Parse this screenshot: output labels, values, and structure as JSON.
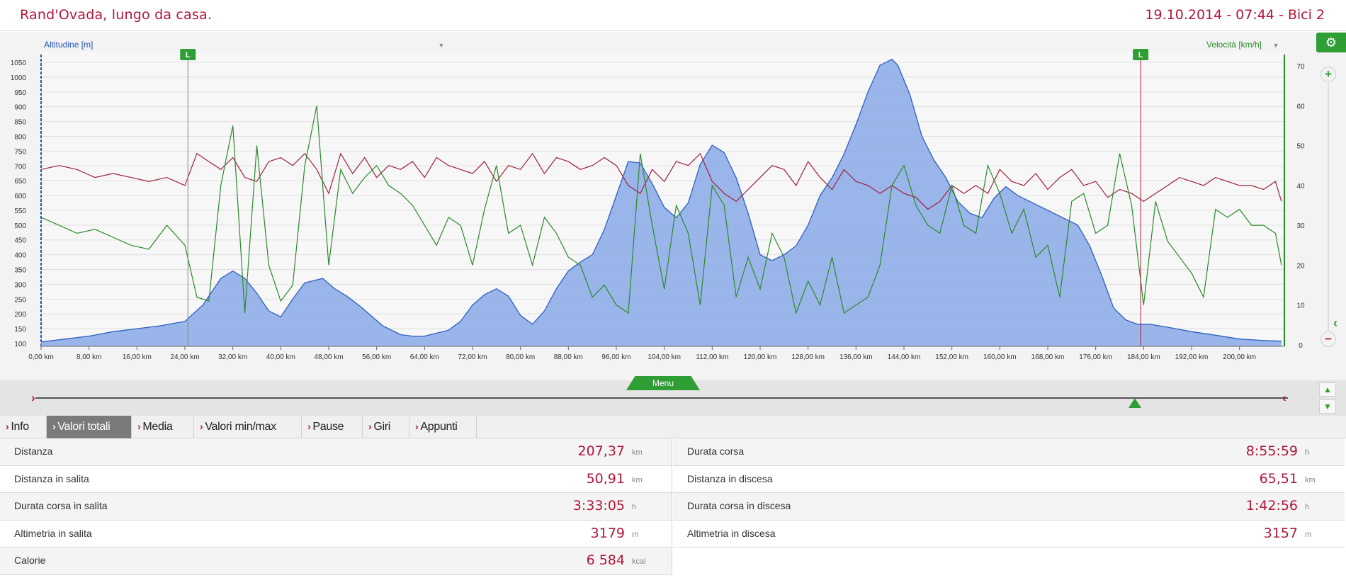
{
  "header": {
    "title": "Rand'Ovada, lungo da casa.",
    "meta": "19.10.2014 - 07:44 - Bici 2"
  },
  "chart": {
    "left_axis_label": "Altitudine [m]",
    "right_axis_label": "Velocità [km/h]",
    "lap_marker_label": "L",
    "settings_icon": "gear-icon",
    "colors": {
      "altitude_fill": "#8aa9e6",
      "altitude_line": "#2d5fc4",
      "speed": "#2a8a2a",
      "series3": "#a0203a",
      "lap_marker": "#2f9e34"
    }
  },
  "chart_data": {
    "type": "area",
    "x_unit": "km",
    "x_ticks": [
      "0,00 km",
      "8,00 km",
      "16,00 km",
      "24,00 km",
      "32,00 km",
      "40,00 km",
      "48,00 km",
      "56,00 km",
      "64,00 km",
      "72,00 km",
      "80,00 km",
      "88,00 km",
      "96,00 km",
      "104,00 km",
      "112,00 km",
      "120,00 km",
      "128,00 km",
      "136,00 km",
      "144,00 km",
      "152,00 km",
      "160,00 km",
      "168,00 km",
      "176,00 km",
      "184,00 km",
      "192,00 km",
      "200,00 km"
    ],
    "xlim": [
      0,
      207.37
    ],
    "y_left": {
      "label": "Altitudine [m]",
      "ylim": [
        100,
        1050
      ],
      "ticks": [
        "1050",
        "1000",
        "950",
        "900",
        "850",
        "800",
        "750",
        "700",
        "650",
        "600",
        "550",
        "500",
        "450",
        "400",
        "350",
        "300",
        "250",
        "200",
        "150",
        "100"
      ]
    },
    "y_right": {
      "label": "Velocità [km/h]",
      "ylim": [
        0,
        70
      ],
      "ticks": [
        "70",
        "60",
        "50",
        "40",
        "30",
        "20",
        "10",
        "0"
      ]
    },
    "lap_markers_km": [
      24.5,
      183.5
    ],
    "series": [
      {
        "name": "Altitudine [m]",
        "axis": "left",
        "x": [
          0,
          4,
          8,
          12,
          16,
          20,
          24,
          27,
          30,
          32,
          34,
          36,
          38,
          40,
          42,
          44,
          47,
          49,
          51,
          53,
          55,
          57,
          60,
          62,
          64,
          66,
          68,
          70,
          72,
          74,
          76,
          78,
          80,
          82,
          84,
          86,
          88,
          90,
          92,
          94,
          96,
          98,
          100,
          102,
          104,
          106,
          108,
          110,
          112,
          114,
          116,
          118,
          120,
          122,
          124,
          126,
          128,
          130,
          132,
          134,
          136,
          138,
          140,
          142,
          143,
          145,
          147,
          149,
          151,
          153,
          155,
          157,
          159,
          161,
          163,
          165,
          167,
          169,
          171,
          173,
          175,
          177,
          179,
          181,
          183,
          185,
          188,
          192,
          196,
          200,
          204,
          207
        ],
        "values": [
          105,
          115,
          125,
          140,
          150,
          160,
          175,
          230,
          320,
          345,
          320,
          270,
          210,
          190,
          250,
          305,
          320,
          285,
          260,
          230,
          195,
          160,
          130,
          125,
          125,
          135,
          145,
          175,
          230,
          265,
          285,
          260,
          195,
          165,
          210,
          285,
          345,
          375,
          400,
          485,
          600,
          715,
          710,
          640,
          560,
          525,
          575,
          705,
          770,
          745,
          660,
          540,
          400,
          380,
          400,
          430,
          500,
          600,
          660,
          740,
          840,
          950,
          1040,
          1060,
          1040,
          940,
          800,
          720,
          660,
          580,
          540,
          525,
          590,
          630,
          600,
          580,
          560,
          540,
          520,
          500,
          430,
          330,
          220,
          180,
          165,
          165,
          155,
          140,
          128,
          115,
          110,
          108
        ]
      },
      {
        "name": "Velocità [km/h]",
        "axis": "right",
        "x": [
          0,
          3,
          6,
          9,
          12,
          15,
          18,
          21,
          24,
          26,
          28,
          30,
          32,
          34,
          36,
          38,
          40,
          42,
          44,
          46,
          48,
          50,
          52,
          54,
          56,
          58,
          60,
          62,
          64,
          66,
          68,
          70,
          72,
          74,
          76,
          78,
          80,
          82,
          84,
          86,
          88,
          90,
          92,
          94,
          96,
          98,
          100,
          102,
          104,
          106,
          108,
          110,
          112,
          114,
          116,
          118,
          120,
          122,
          124,
          126,
          128,
          130,
          132,
          134,
          136,
          138,
          140,
          142,
          144,
          146,
          148,
          150,
          152,
          154,
          156,
          158,
          160,
          162,
          164,
          166,
          168,
          170,
          172,
          174,
          176,
          178,
          180,
          182,
          184,
          186,
          188,
          190,
          192,
          194,
          196,
          198,
          200,
          202,
          204,
          206,
          207
        ],
        "values": [
          32,
          30,
          28,
          29,
          27,
          25,
          24,
          30,
          25,
          12,
          11,
          40,
          55,
          8,
          50,
          20,
          11,
          15,
          45,
          60,
          20,
          44,
          38,
          42,
          45,
          40,
          38,
          35,
          30,
          25,
          32,
          30,
          20,
          34,
          45,
          28,
          30,
          20,
          32,
          28,
          22,
          20,
          12,
          15,
          10,
          8,
          48,
          30,
          14,
          35,
          28,
          10,
          40,
          35,
          12,
          22,
          14,
          28,
          22,
          8,
          16,
          10,
          22,
          8,
          10,
          12,
          20,
          40,
          45,
          35,
          30,
          28,
          40,
          30,
          28,
          45,
          38,
          28,
          34,
          22,
          25,
          12,
          36,
          38,
          28,
          30,
          48,
          35,
          10,
          36,
          26,
          22,
          18,
          12,
          34,
          32,
          34,
          30,
          30,
          28,
          20
        ]
      },
      {
        "name": "",
        "axis": "right",
        "x": [
          0,
          3,
          6,
          9,
          12,
          15,
          18,
          21,
          24,
          26,
          28,
          30,
          32,
          34,
          36,
          38,
          40,
          42,
          44,
          46,
          48,
          50,
          52,
          54,
          56,
          58,
          60,
          62,
          64,
          66,
          68,
          70,
          72,
          74,
          76,
          78,
          80,
          82,
          84,
          86,
          88,
          90,
          92,
          94,
          96,
          98,
          100,
          102,
          104,
          106,
          108,
          110,
          112,
          114,
          116,
          118,
          120,
          122,
          124,
          126,
          128,
          130,
          132,
          134,
          136,
          138,
          140,
          142,
          144,
          146,
          148,
          150,
          152,
          154,
          156,
          158,
          160,
          162,
          164,
          166,
          168,
          170,
          172,
          174,
          176,
          178,
          180,
          182,
          184,
          186,
          188,
          190,
          192,
          194,
          196,
          198,
          200,
          202,
          204,
          206,
          207
        ],
        "values": [
          44,
          45,
          44,
          42,
          43,
          42,
          41,
          42,
          40,
          48,
          46,
          44,
          47,
          42,
          41,
          46,
          47,
          45,
          48,
          44,
          38,
          48,
          43,
          47,
          42,
          45,
          44,
          46,
          42,
          47,
          45,
          44,
          43,
          46,
          41,
          45,
          44,
          48,
          43,
          47,
          46,
          44,
          45,
          47,
          45,
          40,
          38,
          44,
          41,
          46,
          45,
          48,
          41,
          38,
          36,
          39,
          42,
          45,
          44,
          40,
          46,
          42,
          39,
          44,
          41,
          40,
          38,
          40,
          38,
          37,
          34,
          36,
          40,
          38,
          40,
          38,
          44,
          41,
          40,
          43,
          39,
          42,
          44,
          40,
          41,
          37,
          39,
          38,
          36,
          38,
          40,
          42,
          41,
          40,
          42,
          41,
          40,
          40,
          39,
          41,
          36
        ]
      }
    ]
  },
  "menu": {
    "label": "Menu"
  },
  "tabs": [
    {
      "label": "Info",
      "active": false
    },
    {
      "label": "Valori totali",
      "active": true
    },
    {
      "label": "Media",
      "active": false
    },
    {
      "label": "Valori min/max",
      "active": false
    },
    {
      "label": "Pause",
      "active": false
    },
    {
      "label": "Giri",
      "active": false
    },
    {
      "label": "Appunti",
      "active": false
    }
  ],
  "stats": {
    "left": [
      {
        "label": "Distanza",
        "value": "207,37",
        "unit": "km"
      },
      {
        "label": "Distanza in salita",
        "value": "50,91",
        "unit": "km"
      },
      {
        "label": "Durata corsa in salita",
        "value": "3:33:05",
        "unit": "h"
      },
      {
        "label": "Altimetria in salita",
        "value": "3179",
        "unit": "m"
      },
      {
        "label": "Calorie",
        "value": "6 584",
        "unit": "kcal"
      }
    ],
    "right": [
      {
        "label": "Durata corsa",
        "value": "8:55:59",
        "unit": "h"
      },
      {
        "label": "Distanza in discesa",
        "value": "65,51",
        "unit": "km"
      },
      {
        "label": "Durata corsa in discesa",
        "value": "1:42:56",
        "unit": "h"
      },
      {
        "label": "Altimetria in discesa",
        "value": "3157",
        "unit": "m"
      }
    ]
  }
}
